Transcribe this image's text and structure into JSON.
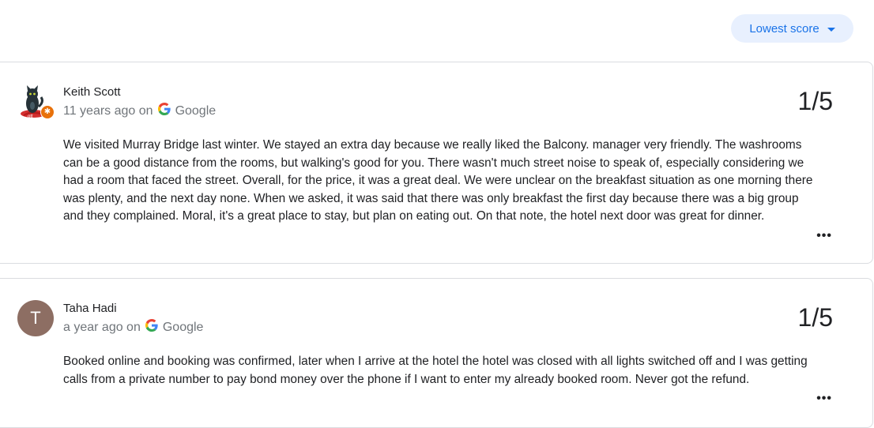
{
  "sort": {
    "label": "Lowest score",
    "icon": "caret-down-icon"
  },
  "reviews": [
    {
      "author": "Keith Scott",
      "time": "11 years ago on",
      "source": "Google",
      "score": "1/5",
      "text": "We visited Murray Bridge last winter. We stayed an extra day because we really liked the Balcony. manager very friendly. The washrooms can be a good distance from the rooms, but walking's good for you. There wasn't much street noise to speak of, especially considering we had a room that faced the street. Overall, for the price, it was a great deal. We were unclear on the breakfast situation as one morning there was plenty, and the next day none. When we asked, it was said that there was only breakfast the first day because there was a big group and they complained. Moral, it's a great place to stay, but plan on eating out. On that note, the hotel next door was great for dinner.",
      "avatar_icon": "cat-avatar-icon",
      "badge_icon": "local-guide-badge-icon"
    },
    {
      "author": "Taha Hadi",
      "time": "a year ago on",
      "source": "Google",
      "score": "1/5",
      "text": "Booked online and booking was confirmed, later when I arrive at the hotel the hotel was closed with all lights switched off and I was getting calls from a private number to pay bond money over the phone if I want to enter my already booked room. Never got the refund.",
      "avatar_letter": "T",
      "avatar_color": "#8d6e63"
    }
  ],
  "more_label": "•••",
  "colors": {
    "accent": "#1a73e8",
    "chip_bg": "#e8f0fe",
    "muted": "#70757a"
  }
}
